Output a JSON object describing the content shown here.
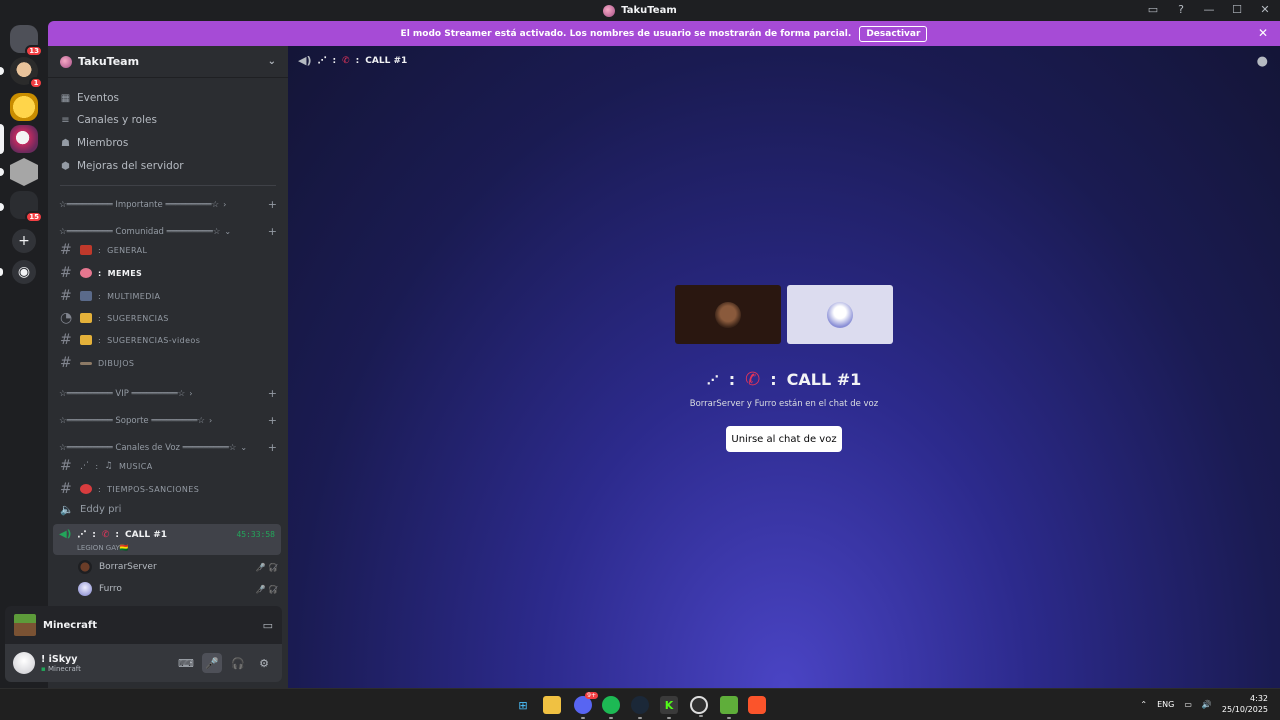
{
  "window": {
    "title": "TakuTeam"
  },
  "guilds": {
    "badges": [
      "13",
      "1",
      "15"
    ]
  },
  "banner": {
    "text": "El modo Streamer está activado. Los nombres de usuario se mostrarán de forma parcial.",
    "button": "Desactivar"
  },
  "server": {
    "name": "TakuTeam",
    "menu": [
      "Eventos",
      "Canales y roles",
      "Miembros",
      "Mejoras del servidor"
    ]
  },
  "categories": [
    "☆═════════ Importante ═════════☆",
    "☆═════════ Comunidad ═════════☆",
    "☆═════════ VIP ═════════☆",
    "☆═════════ Soporte ═════════☆",
    "☆═════════ Canales de Voz ═════════☆"
  ],
  "channels": {
    "general": "GENERAL",
    "memes": "MEMES",
    "multimedia": "MULTIMEDIA",
    "sugerencias": "SUGERENCIAS",
    "sugerencias_videos": "SUGERENCIAS-videos",
    "dibujos": "DIBUJOS",
    "musica": "MUSICA",
    "tiempos": "TIEMPOS-SANCIONES",
    "eddy": "Eddy pri",
    "call": "CALL #1",
    "call_time": "45:33:58",
    "call_sub": "LEGION GAY🇧🇴",
    "sep": ":"
  },
  "voice_users": [
    "BorrarServer",
    "Furro"
  ],
  "activity": {
    "game": "Minecraft"
  },
  "user_panel": {
    "name": "! iSkyy",
    "status": "Minecraft"
  },
  "main": {
    "header": "CALL #1",
    "title": "CALL #1",
    "subtitle": "BorrarServer y Furro están en el chat de voz",
    "join_button": "Unirse al chat de voz"
  },
  "taskbar": {
    "lang": "ENG",
    "time": "4:32",
    "date": "25/10/2025",
    "discord_badge": "9+"
  }
}
